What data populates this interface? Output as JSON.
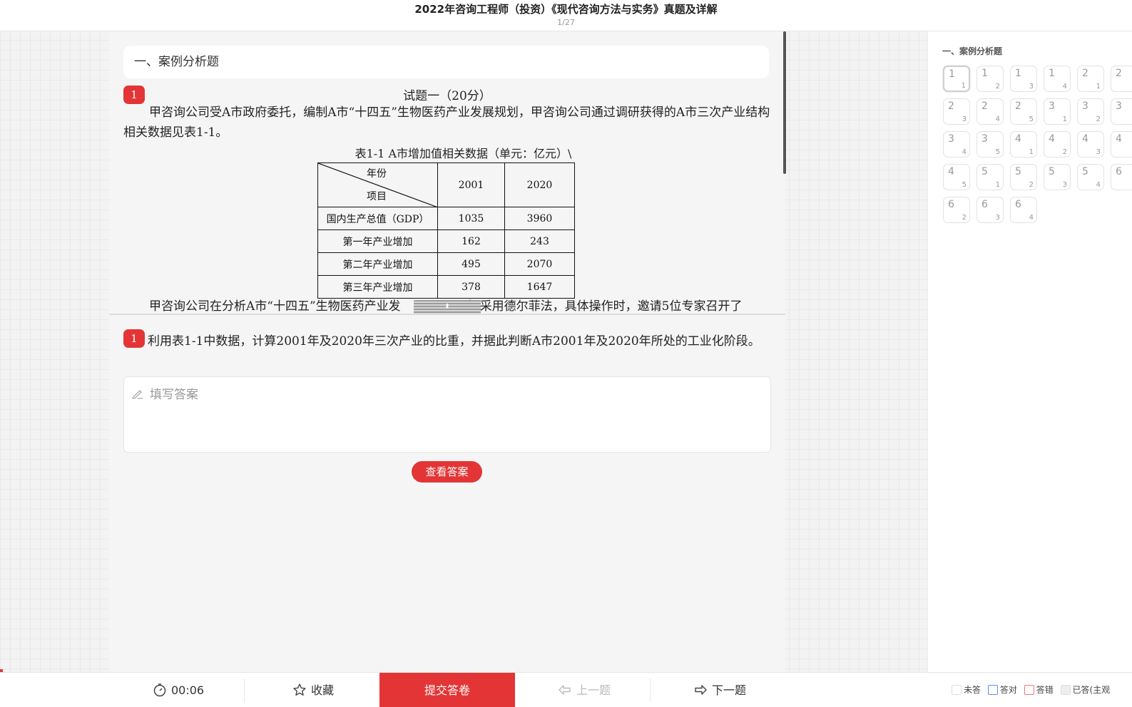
{
  "header": {
    "title": "2022年咨询工程师（投资）《现代咨询方法与实务》真题及详解",
    "pager": "1/27"
  },
  "section": {
    "title": "一、案例分析题"
  },
  "question": {
    "number": "1",
    "title": "试题一（20分）",
    "para1": "甲咨询公司受A市政府委托，编制A市“十四五”生物医药产业发展规划，甲咨询公司通过调研获得的A市三次产业结构相关数据见表1-1。",
    "table_caption": "表1-1    A市增加值相关数据（单元：亿元）\\",
    "table": {
      "diag_top": "年份",
      "diag_bottom": "项目",
      "years": [
        "2001",
        "2020"
      ],
      "rows": [
        {
          "label": "国内生产总值（GDP）",
          "v2001": "1035",
          "v2020": "3960"
        },
        {
          "label": "第一年产业增加",
          "v2001": "162",
          "v2020": "243"
        },
        {
          "label": "第二年产业增加",
          "v2001": "495",
          "v2020": "2070"
        },
        {
          "label": "第三年产业增加",
          "v2001": "378",
          "v2020": "1647"
        }
      ]
    },
    "para2_left": "甲咨询公司在分析A市“十四五”生物医药产业发",
    "para2_right": "拟采用德尔菲法，具体操作时，邀请5位专家召开了",
    "sub_number": "1",
    "sub_question": "利用表1-1中数据，计算2001年及2020年三次产业的比重，并据此判断A市2001年及2020年所处的工业化阶段。"
  },
  "answer": {
    "placeholder": "填写答案",
    "view_button": "查看答案"
  },
  "right_panel": {
    "title": "一、案例分析题",
    "cells": [
      [
        "1",
        "1"
      ],
      [
        "1",
        "2"
      ],
      [
        "1",
        "3"
      ],
      [
        "1",
        "4"
      ],
      [
        "2",
        "1"
      ],
      [
        "2",
        ""
      ],
      [
        "2",
        "3"
      ],
      [
        "2",
        "4"
      ],
      [
        "2",
        "5"
      ],
      [
        "3",
        "1"
      ],
      [
        "3",
        "2"
      ],
      [
        "3",
        ""
      ],
      [
        "3",
        "4"
      ],
      [
        "3",
        "5"
      ],
      [
        "4",
        "1"
      ],
      [
        "4",
        "2"
      ],
      [
        "4",
        "3"
      ],
      [
        "4",
        ""
      ],
      [
        "4",
        "5"
      ],
      [
        "5",
        "1"
      ],
      [
        "5",
        "2"
      ],
      [
        "5",
        "3"
      ],
      [
        "5",
        "4"
      ],
      [
        "6",
        ""
      ],
      [
        "6",
        "2"
      ],
      [
        "6",
        "3"
      ],
      [
        "6",
        "4"
      ]
    ]
  },
  "bottom": {
    "timer": "00:06",
    "favorite": "收藏",
    "submit": "提交答卷",
    "prev": "上一题",
    "next": "下一题"
  },
  "legend": {
    "unanswered": "未答",
    "correct": "答对",
    "wrong": "答错",
    "answered_subjective": "已答(主观"
  },
  "colors": {
    "accent": "#e33535"
  }
}
